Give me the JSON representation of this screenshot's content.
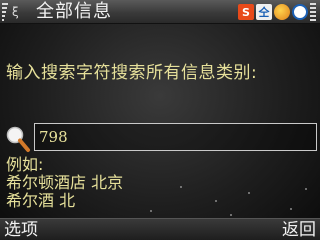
{
  "title_bar": {
    "title": "全部信息",
    "status_icons": [
      "s-app-icon",
      "input-method-icon",
      "browser-icon",
      "clock-icon"
    ]
  },
  "prompt": {
    "text": "输入搜索字符搜索所有信息类别:"
  },
  "search": {
    "value": "798",
    "icon": "magnifier-icon"
  },
  "examples": {
    "heading": "例如:",
    "lines": [
      "希尔顿酒店 北京",
      "希尔酒 北"
    ]
  },
  "softkeys": {
    "left": "选项",
    "right": "返回"
  }
}
